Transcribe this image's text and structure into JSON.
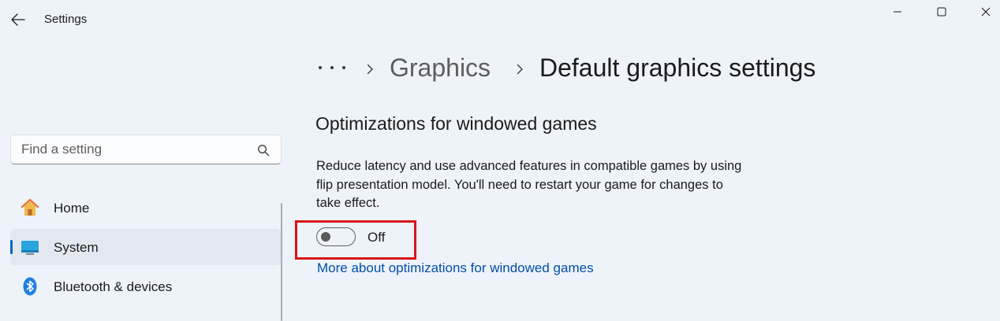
{
  "titlebar": {
    "title": "Settings",
    "back_icon": "arrow-left-icon",
    "controls": [
      "minimize-icon",
      "maximize-icon",
      "close-icon"
    ]
  },
  "search": {
    "placeholder": "Find a setting",
    "value": "",
    "icon": "search-icon"
  },
  "sidebar": {
    "items": [
      {
        "label": "Home",
        "icon": "home-icon",
        "selected": false
      },
      {
        "label": "System",
        "icon": "system-display-icon",
        "selected": true
      },
      {
        "label": "Bluetooth & devices",
        "icon": "bluetooth-icon",
        "selected": false
      }
    ]
  },
  "breadcrumb": {
    "parent": "Graphics",
    "current": "Default graphics settings"
  },
  "section": {
    "title": "Optimizations for windowed games",
    "description": "Reduce latency and use advanced features in compatible games by using flip presentation model. You'll need to restart your game for changes to take effect.",
    "toggle_state": "Off",
    "toggle_on": false,
    "link": "More about optimizations for windowed games"
  },
  "colors": {
    "accent": "#0067c0",
    "highlight_box": "#d7141a",
    "link": "#0050a8",
    "background": "#eef2f9"
  }
}
